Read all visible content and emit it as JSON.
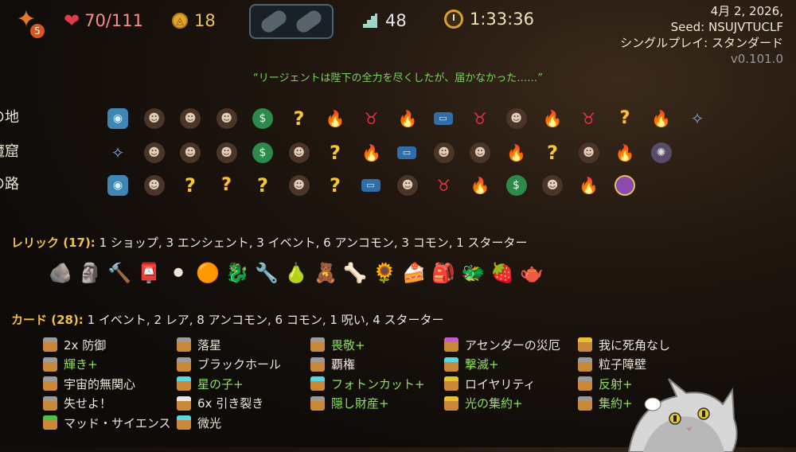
{
  "hud": {
    "ascension": "5",
    "hp": "70/111",
    "gold": "18",
    "floor": "48",
    "time": "1:33:36"
  },
  "info": {
    "date": "4月 2, 2026,",
    "seed_label": "Seed:",
    "seed": "NSUJVTUCLF",
    "mode": "シングルプレイ: スタンダード",
    "version": "v0.101.0"
  },
  "quote": "“リージェントは陛下の全力を尽くしたが、届かなかった……”",
  "map": [
    {
      "label": "繁茂の地",
      "nodes": [
        "boss",
        "monster",
        "monster",
        "monster",
        "shop",
        "unknown",
        "rest",
        "elite",
        "rest",
        "treasure",
        "elite",
        "monster",
        "rest",
        "elite",
        "unknownElite",
        "rest",
        "ancient"
      ]
    },
    {
      "label": "魔窟",
      "nodes": [
        "ancient",
        "monster",
        "monster",
        "monster",
        "shop",
        "monster",
        "unknown",
        "rest",
        "treasure",
        "monster",
        "monster",
        "rest",
        "unknown",
        "monster",
        "rest",
        "bossB"
      ]
    },
    {
      "label": "栄光の路",
      "nodes": [
        "boss",
        "monster",
        "unknown",
        "unknownElite",
        "unknown",
        "monster",
        "unknown",
        "treasure",
        "monster",
        "elite",
        "rest",
        "shop",
        "monster",
        "rest",
        "gem"
      ]
    }
  ],
  "relics_header": {
    "title": "レリック (17):",
    "summary": "1 ショップ,  3 エンシェント, 3 イベント, 6 アンコモン, 3 コモン, 1 スターター"
  },
  "relics": [
    "🪨",
    "🗿",
    "🔨",
    "📮",
    "⚫",
    "🟠",
    "🐉",
    "🔧",
    "🍐",
    "🧸",
    "🦴",
    "🌻",
    "🍰",
    "🎒",
    "🐲",
    "🍓",
    "🫖"
  ],
  "cards_header": {
    "title": "カード (28):",
    "summary": "1 イベント, 2 レア, 8 アンコモン, 6 コモン, 1 呪い, 4 スターター"
  },
  "cards": [
    [
      {
        "name": "2x 防御",
        "up": false,
        "top": "#9a9a9a"
      },
      {
        "name": "輝き+",
        "up": true,
        "top": "#9a9a9a"
      },
      {
        "name": "宇宙的無関心",
        "up": false,
        "top": "#9a9a9a"
      },
      {
        "name": "失せよ！",
        "up": false,
        "top": "#9a9a9a"
      },
      {
        "name": "マッド・サイエンス",
        "up": false,
        "top": "#4ac24a"
      }
    ],
    [
      {
        "name": "落星",
        "up": false,
        "top": "#9a9a9a"
      },
      {
        "name": "ブラックホール",
        "up": false,
        "top": "#9a9a9a"
      },
      {
        "name": "星の子+",
        "up": true,
        "top": "#5ad6e0"
      },
      {
        "name": "6x 引き裂き",
        "up": false,
        "top": "#e6e6e6"
      },
      {
        "name": "微光",
        "up": false,
        "top": "#5ad6e0"
      }
    ],
    [
      {
        "name": "畏敬+",
        "up": true,
        "top": "#9a9a9a"
      },
      {
        "name": "覇権",
        "up": false,
        "top": "#9a9a9a"
      },
      {
        "name": "フォトンカット+",
        "up": true,
        "top": "#5ad6e0"
      },
      {
        "name": "隠し財産+",
        "up": true,
        "top": "#9a9a9a"
      }
    ],
    [
      {
        "name": "アセンダーの災厄",
        "up": false,
        "top": "#c25ad6"
      },
      {
        "name": "撃滅+",
        "up": true,
        "top": "#5ad6e0"
      },
      {
        "name": "ロイヤリティ",
        "up": false,
        "top": "#e8c030"
      },
      {
        "name": "光の集約+",
        "up": true,
        "top": "#e8c030"
      }
    ],
    [
      {
        "name": "我に死角なし",
        "up": false,
        "top": "#e8c030"
      },
      {
        "name": "粒子障壁",
        "up": false,
        "top": "#9a9a9a"
      },
      {
        "name": "反射+",
        "up": true,
        "top": "#9a9a9a"
      },
      {
        "name": "集約+",
        "up": true,
        "top": "#9a9a9a"
      }
    ]
  ]
}
